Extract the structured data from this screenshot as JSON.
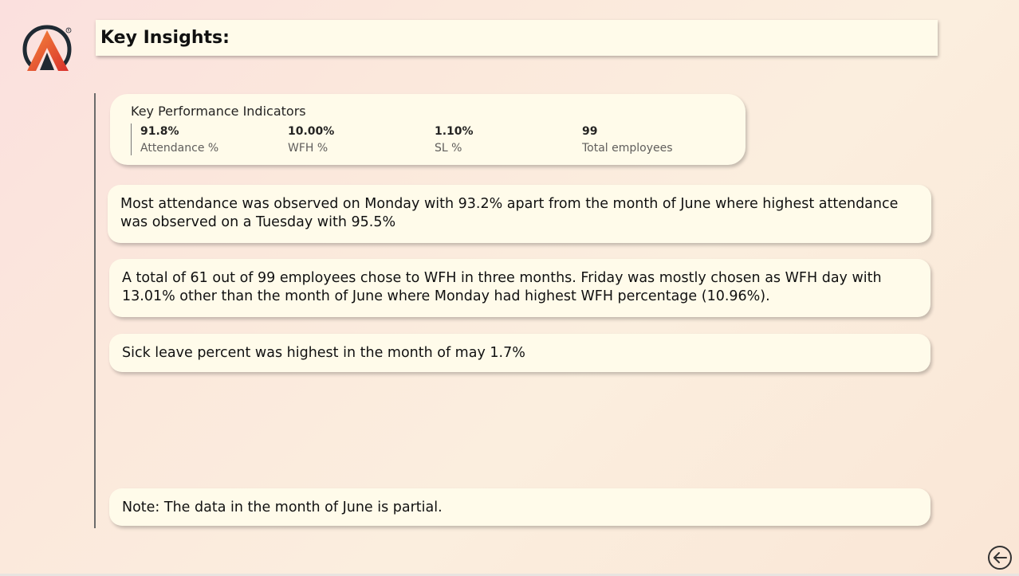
{
  "header": {
    "title": "Key Insights:",
    "logo_icon": "brand-logo-icon"
  },
  "kpi": {
    "heading": "Key Performance Indicators",
    "items": [
      {
        "value": "91.8%",
        "label": "Attendance %"
      },
      {
        "value": "10.00%",
        "label": "WFH %"
      },
      {
        "value": "1.10%",
        "label": "SL %"
      },
      {
        "value": "99",
        "label": "Total employees"
      }
    ]
  },
  "insights": [
    "Most attendance was observed on Monday with 93.2% apart from the month of June where highest attendance was observed on a Tuesday with 95.5%",
    "A total of 61 out of 99 employees chose to WFH in three months. Friday was mostly chosen as WFH day with 13.01% other than the month of June where Monday had highest WFH percentage (10.96%).",
    "Sick leave percent was highest in the month of may 1.7%"
  ],
  "note": "Note: The data in the month of June is partial.",
  "nav": {
    "back_icon": "back-arrow-icon"
  },
  "colors": {
    "card_background": "#fffbea",
    "logo_dark": "#1f2a33",
    "logo_orange": "#f0663b",
    "logo_red": "#d9302b"
  }
}
